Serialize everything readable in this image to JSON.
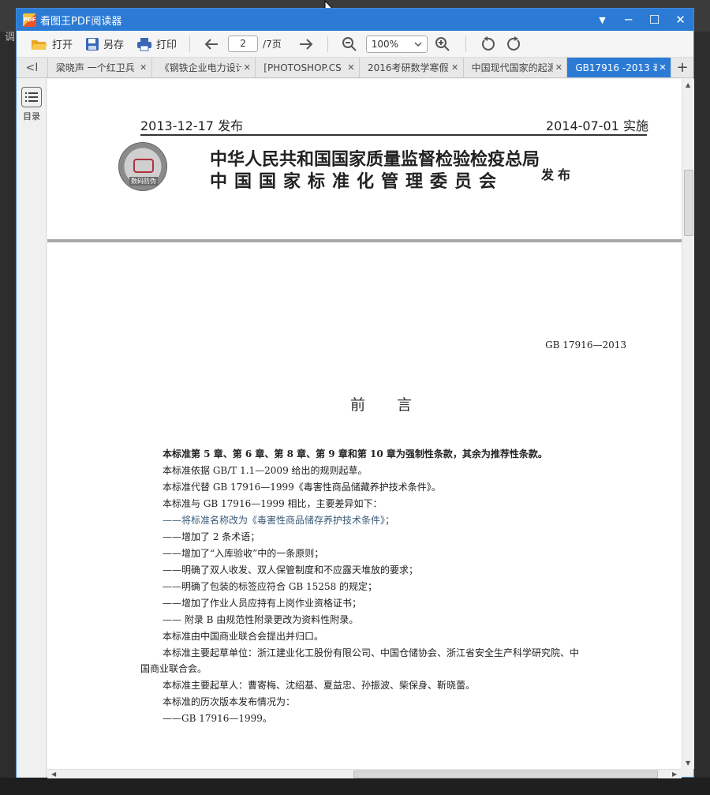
{
  "window": {
    "title": "看图王PDF阅读器",
    "logo_text": "PDF",
    "controls": {
      "menu": "▼",
      "minimize": "─",
      "maximize": "☐",
      "close": "✕"
    }
  },
  "background_glyph": "调",
  "toolbar": {
    "open_label": "打开",
    "save_as_label": "另存",
    "print_label": "打印",
    "current_page": "2",
    "total_pages": "/7页",
    "zoom": "100%"
  },
  "tabs": {
    "nav_label": "<I",
    "add_label": "+",
    "items": [
      {
        "label": "梁晓声 一个红卫兵",
        "close": "✕"
      },
      {
        "label": "《钢铁企业电力设计",
        "close": "✕"
      },
      {
        "label": "[PHOTOSHOP.CS",
        "close": "✕"
      },
      {
        "label": "2016考研数学寒假",
        "close": "✕"
      },
      {
        "label": "中国现代国家的起源",
        "close": "✕"
      },
      {
        "label": "GB17916 -2013 毒",
        "close": "✕"
      }
    ]
  },
  "sidebar": {
    "toc_label": "目录"
  },
  "document": {
    "publish_date": "2013-12-17 发布",
    "implement_date": "2014-07-01 实施",
    "seal_label": "数码防伪",
    "org_line1": "中华人民共和国国家质量监督检验检疫总局",
    "org_line2": "中国国家标准化管理委员会",
    "issue_label": "发布",
    "standard_code": "GB 17916—2013",
    "preface_title": "前言",
    "lines": [
      "本标准第 5 章、第 6 章、第 8 章、第 9 章和第 10 章为强制性条款，其余为推荐性条款。",
      "本标准依据 GB/T 1.1—2009 给出的规则起草。",
      "本标准代替 GB 17916—1999《毒害性商品储藏养护技术条件》。",
      "本标准与 GB 17916—1999 相比，主要差异如下：",
      "——将标准名称改为《毒害性商品储存养护技术条件》；",
      "——增加了 2 条术语；",
      "——增加了“入库验收”中的一条原则；",
      "——明确了双人收发、双人保管制度和不应露天堆放的要求；",
      "——明确了包装的标签应符合 GB 15258 的规定；",
      "——增加了作业人员应持有上岗作业资格证书；",
      "—— 附录 B 由规范性附录更改为资料性附录。",
      "本标准由中国商业联合会提出并归口。",
      "本标准主要起草单位：浙江建业化工股份有限公司、中国仓储协会、浙江省安全生产科学研究院、中",
      "国商业联合会。",
      "本标准主要起草人：曹寄梅、沈绍基、夏益忠、孙振波、柴保身、靳晓蕾。",
      "本标准的历次版本发布情况为：",
      "——GB 17916—1999。"
    ]
  }
}
